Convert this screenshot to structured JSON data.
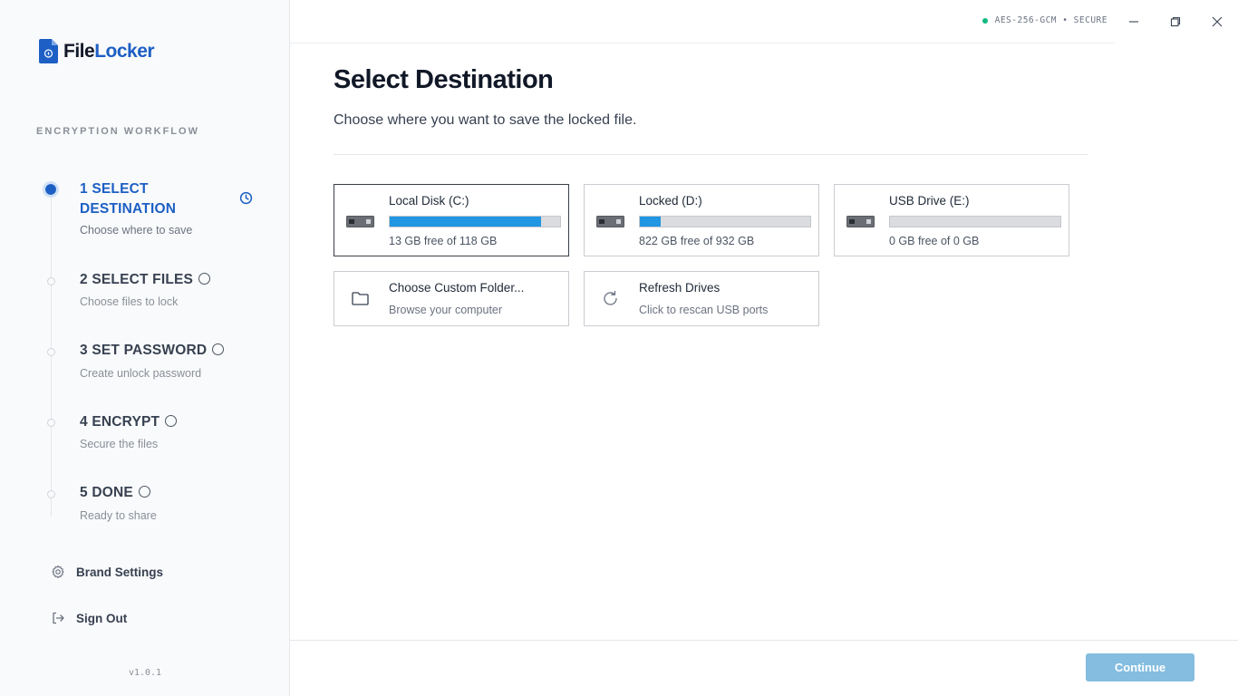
{
  "app": {
    "name_part1": "File",
    "name_part2": "Locker"
  },
  "sidebar": {
    "section_label": "ENCRYPTION WORKFLOW",
    "steps": [
      {
        "title": "1 SELECT DESTINATION",
        "subtitle": "Choose where to save",
        "state": "active"
      },
      {
        "title": "2 SELECT FILES",
        "subtitle": "Choose files to lock",
        "state": "pending"
      },
      {
        "title": "3 SET PASSWORD",
        "subtitle": "Create unlock password",
        "state": "pending"
      },
      {
        "title": "4 ENCRYPT",
        "subtitle": "Secure the files",
        "state": "pending"
      },
      {
        "title": "5 DONE",
        "subtitle": "Ready to share",
        "state": "pending"
      }
    ],
    "links": {
      "brand_settings": "Brand Settings",
      "sign_out": "Sign Out"
    },
    "version": "v1.0.1"
  },
  "topbar": {
    "security_status": "AES-256-GCM • SECURE"
  },
  "main": {
    "title": "Select Destination",
    "subtitle": "Choose where you want to save the locked file.",
    "drives": [
      {
        "name": "Local Disk (C:)",
        "free_text": "13 GB free of 118 GB",
        "used_fraction": 0.89,
        "selected": true
      },
      {
        "name": "Locked (D:)",
        "free_text": "822 GB free of 932 GB",
        "used_fraction": 0.12,
        "selected": false
      },
      {
        "name": "USB Drive (E:)",
        "free_text": "0 GB free of 0 GB",
        "used_fraction": 0,
        "selected": false
      }
    ],
    "actions": [
      {
        "title": "Choose Custom Folder...",
        "subtitle": "Browse your computer",
        "icon": "folder-icon"
      },
      {
        "title": "Refresh Drives",
        "subtitle": "Click to rescan USB ports",
        "icon": "refresh-icon"
      }
    ],
    "continue_label": "Continue"
  },
  "colors": {
    "accent": "#1d5fc4",
    "progress": "#2196e3",
    "secure_dot": "#10b981",
    "continue_disabled": "#84bde0"
  }
}
